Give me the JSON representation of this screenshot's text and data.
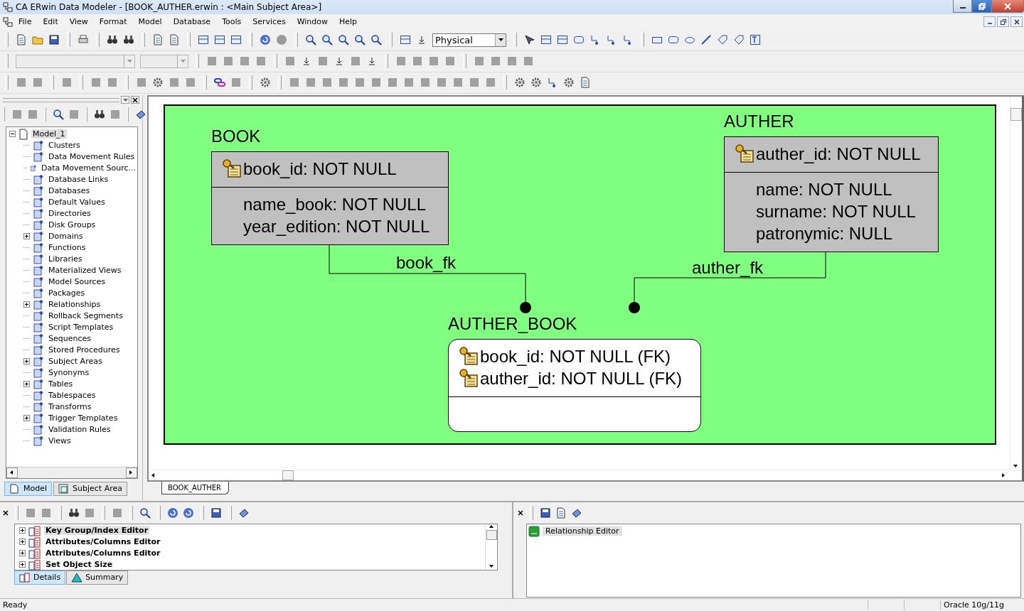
{
  "window": {
    "title": "CA ERwin Data Modeler - [BOOK_AUTHER.erwin : <Main Subject Area>]"
  },
  "menu": [
    "File",
    "Edit",
    "View",
    "Format",
    "Model",
    "Database",
    "Tools",
    "Services",
    "Window",
    "Help"
  ],
  "toolbar": {
    "view_mode": "Physical"
  },
  "model_explorer": {
    "tree": [
      {
        "label": "Model_1",
        "expanded": true,
        "selected": true,
        "children": [
          {
            "label": "Clusters",
            "selected": false
          },
          {
            "label": "Data Movement Rules",
            "selected": false
          },
          {
            "label": "Data Movement Sourc...",
            "selected": false
          },
          {
            "label": "Database Links",
            "selected": false
          },
          {
            "label": "Databases",
            "selected": false
          },
          {
            "label": "Default Values",
            "selected": false
          },
          {
            "label": "Directories",
            "selected": false
          },
          {
            "label": "Disk Groups",
            "selected": false
          },
          {
            "label": "Domains",
            "selected": false,
            "expanded": false
          },
          {
            "label": "Functions",
            "selected": false
          },
          {
            "label": "Libraries",
            "selected": false
          },
          {
            "label": "Materialized Views",
            "selected": false
          },
          {
            "label": "Model Sources",
            "selected": false
          },
          {
            "label": "Packages",
            "selected": false
          },
          {
            "label": "Relationships",
            "selected": false,
            "expanded": false
          },
          {
            "label": "Rollback Segments",
            "selected": false
          },
          {
            "label": "Script Templates",
            "selected": false
          },
          {
            "label": "Sequences",
            "selected": false
          },
          {
            "label": "Stored Procedures",
            "selected": false
          },
          {
            "label": "Subject Areas",
            "selected": false,
            "expanded": false
          },
          {
            "label": "Synonyms",
            "selected": false
          },
          {
            "label": "Tables",
            "selected": false,
            "expanded": false
          },
          {
            "label": "Tablespaces",
            "selected": false
          },
          {
            "label": "Transforms",
            "selected": false
          },
          {
            "label": "Trigger Templates",
            "selected": false,
            "expanded": false
          },
          {
            "label": "Validation Rules",
            "selected": false
          },
          {
            "label": "Views",
            "selected": false
          }
        ]
      }
    ],
    "tabs": [
      {
        "label": "Model",
        "selected": true
      },
      {
        "label": "Subject Area",
        "selected": false
      }
    ]
  },
  "diagram": {
    "entities": [
      {
        "name": "BOOK",
        "kind": "independent",
        "keys": [
          "book_id: NOT NULL"
        ],
        "attributes": [
          "name_book: NOT NULL",
          "year_edition: NOT NULL"
        ]
      },
      {
        "name": "AUTHER",
        "kind": "independent",
        "keys": [
          "auther_id: NOT NULL"
        ],
        "attributes": [
          "name: NOT NULL",
          "surname: NOT NULL",
          "patronymic: NULL"
        ]
      },
      {
        "name": "AUTHER_BOOK",
        "kind": "dependent",
        "keys": [
          "book_id: NOT NULL (FK)",
          "auther_id: NOT NULL (FK)"
        ]
      }
    ],
    "relationships": [
      {
        "label": "book_fk"
      },
      {
        "label": "auther_fk"
      }
    ],
    "tabs": [
      {
        "label": "BOOK_AUTHER",
        "selected": true
      }
    ]
  },
  "editor_list": {
    "items": [
      {
        "label": "Key Group/Index Editor",
        "expanded": false,
        "selected": true
      },
      {
        "label": "Attributes/Columns Editor",
        "expanded": false,
        "selected": false
      },
      {
        "label": "Attributes/Columns Editor",
        "expanded": false,
        "selected": false
      },
      {
        "label": "Set Object Size",
        "expanded": false,
        "selected": false
      }
    ],
    "tabs": [
      {
        "label": "Details",
        "selected": true
      },
      {
        "label": "Summary",
        "selected": false
      }
    ]
  },
  "editor_panel": {
    "items": [
      {
        "label": "Relationship Editor",
        "selected": true
      }
    ]
  },
  "status_bar": {
    "message": "Ready",
    "target_database": "Oracle 10g/11g"
  }
}
